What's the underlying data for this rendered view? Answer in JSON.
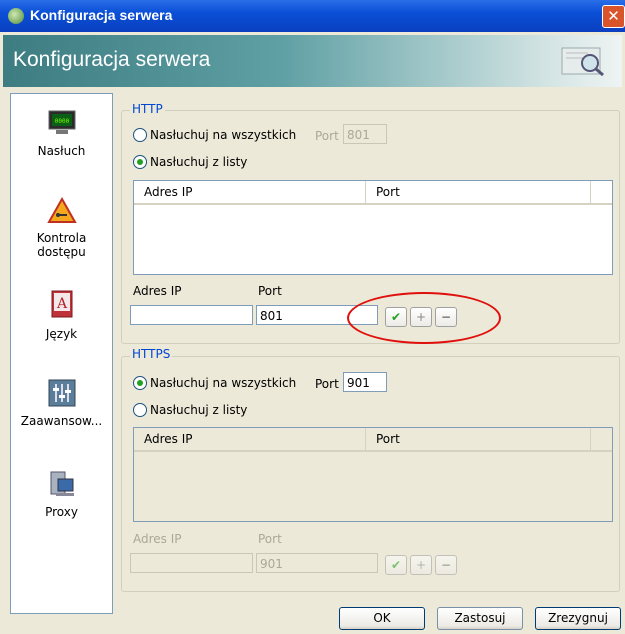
{
  "window": {
    "title": "Konfiguracja serwera",
    "close_icon": "close-icon"
  },
  "header": {
    "title": "Konfiguracja serwera"
  },
  "sidebar": {
    "items": [
      {
        "label": "Nasłuch",
        "icon": "monitor-icon"
      },
      {
        "label": "Kontrola\ndostępu",
        "icon": "warning-icon"
      },
      {
        "label": "Język",
        "icon": "language-book-icon"
      },
      {
        "label": "Zaawansow...",
        "icon": "sliders-icon"
      },
      {
        "label": "Proxy",
        "icon": "computer-icon"
      }
    ]
  },
  "http": {
    "group_label": "HTTP",
    "listen_all": "Nasłuchuj na wszystkich",
    "port_label": "Port",
    "port_value": "801",
    "listen_list": "Nasłuchuj z listy",
    "col_ip": "Adres IP",
    "col_port": "Port",
    "new_ip_label": "Adres IP",
    "new_port_label": "Port",
    "new_ip_value": "",
    "new_port_value": "801"
  },
  "https": {
    "group_label": "HTTPS",
    "listen_all": "Nasłuchuj na wszystkich",
    "port_label": "Port",
    "port_value": "901",
    "listen_list": "Nasłuchuj z listy",
    "col_ip": "Adres IP",
    "col_port": "Port",
    "new_ip_label": "Adres IP",
    "new_port_label": "Port",
    "new_ip_value": "",
    "new_port_value": "901"
  },
  "buttons": {
    "ok": "OK",
    "apply": "Zastosuj",
    "cancel": "Zrezygnuj",
    "confirm_icon": "✔",
    "add_icon": "+",
    "remove_icon": "−"
  },
  "colors": {
    "accent": "#0046d5",
    "highlight": "#e0100c"
  }
}
